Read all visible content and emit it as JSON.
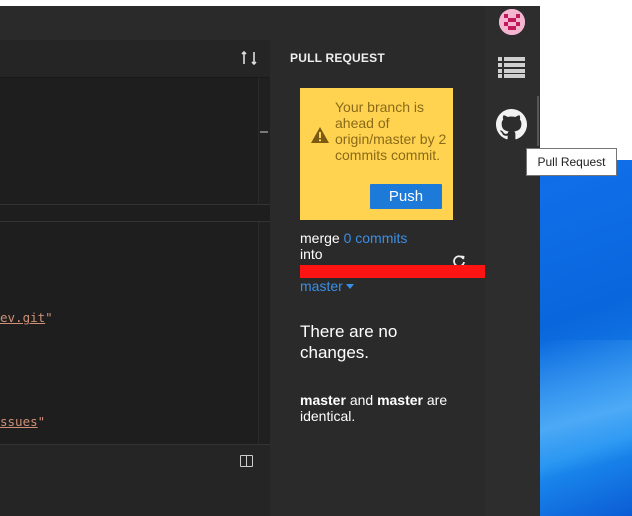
{
  "panel": {
    "title": "PULL REQUEST",
    "alert": {
      "message": "Your branch is ahead of origin/master by 2 commits commit.",
      "push_label": "Push"
    },
    "merge_word": "merge",
    "commits_link": "0 commits",
    "into_word": "into",
    "target_branch": "master",
    "no_changes": "There are no changes.",
    "identical": {
      "branch_a": "master",
      "and_word": "and",
      "branch_b": "master",
      "suffix": "are identical."
    }
  },
  "editor": {
    "code_line_1_text": "ev.git",
    "code_line_2_text": "ssues"
  },
  "tooltip": {
    "label": "Pull Request"
  },
  "icons": {
    "pr_toggle": "pull-request-toggle-icon",
    "split": "split-editor-icon",
    "refresh": "refresh-icon",
    "avatar": "avatar",
    "list": "list-icon",
    "github": "github-icon"
  },
  "colors": {
    "alert_bg": "#ffd34f",
    "push_button": "#1e7ad9",
    "link": "#3b8ee6",
    "redaction": "#ff1414"
  }
}
